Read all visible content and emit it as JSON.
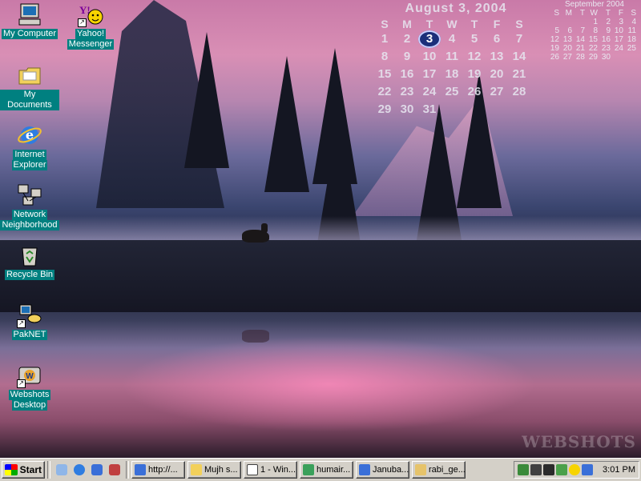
{
  "desktop": {
    "watermark": "WEBSHOTS",
    "icons": [
      {
        "label_1": "My Computer",
        "label_2": "",
        "icon": "my-computer-icon"
      },
      {
        "label_1": "My Documents",
        "label_2": "",
        "icon": "folder-icon"
      },
      {
        "label_1": "Internet",
        "label_2": "Explorer",
        "icon": "internet-explorer-icon"
      },
      {
        "label_1": "Network",
        "label_2": "Neighborhood",
        "icon": "network-icon"
      },
      {
        "label_1": "Recycle Bin",
        "label_2": "",
        "icon": "recycle-bin-icon"
      },
      {
        "label_1": "PakNET",
        "label_2": "",
        "icon": "dialup-icon"
      },
      {
        "label_1": "Webshots",
        "label_2": "Desktop",
        "icon": "webshots-icon"
      },
      {
        "label_1": "Yahoo!",
        "label_2": "Messenger",
        "icon": "yahoo-messenger-icon"
      }
    ]
  },
  "calendar_big": {
    "title": "August 3, 2004",
    "days": [
      "S",
      "M",
      "T",
      "W",
      "T",
      "F",
      "S"
    ],
    "rows": [
      [
        "1",
        "2",
        "3",
        "4",
        "5",
        "6",
        "7"
      ],
      [
        "8",
        "9",
        "10",
        "11",
        "12",
        "13",
        "14"
      ],
      [
        "15",
        "16",
        "17",
        "18",
        "19",
        "20",
        "21"
      ],
      [
        "22",
        "23",
        "24",
        "25",
        "26",
        "27",
        "28"
      ],
      [
        "29",
        "30",
        "31",
        "",
        "",
        "",
        ""
      ]
    ],
    "today": "3"
  },
  "calendar_small": {
    "title": "September 2004",
    "days": [
      "S",
      "M",
      "T",
      "W",
      "T",
      "F",
      "S"
    ],
    "rows": [
      [
        "",
        "",
        "",
        "1",
        "2",
        "3",
        "4"
      ],
      [
        "5",
        "6",
        "7",
        "8",
        "9",
        "10",
        "11"
      ],
      [
        "12",
        "13",
        "14",
        "15",
        "16",
        "17",
        "18"
      ],
      [
        "19",
        "20",
        "21",
        "22",
        "23",
        "24",
        "25"
      ],
      [
        "26",
        "27",
        "28",
        "29",
        "30",
        "",
        ""
      ]
    ]
  },
  "taskbar": {
    "start_label": "Start",
    "quick_launch": [
      "quicklaunch-icon-1",
      "quicklaunch-icon-2",
      "quicklaunch-icon-3",
      "quicklaunch-icon-4"
    ],
    "tasks": [
      {
        "label": "http://...",
        "icon": "browser-icon",
        "color": "#3a6fd8"
      },
      {
        "label": "Mujh s...",
        "icon": "folder-icon",
        "color": "#f2d05b"
      },
      {
        "label": "1 - Win...",
        "icon": "window-icon",
        "color": "#d4d0c8"
      },
      {
        "label": "humair...",
        "icon": "app-icon",
        "color": "#3aa05b"
      },
      {
        "label": "Januba...",
        "icon": "browser-icon",
        "color": "#3a6fd8"
      },
      {
        "label": "rabi_ge...",
        "icon": "file-icon",
        "color": "#e6c36a"
      }
    ],
    "clock": "3:01 PM"
  }
}
